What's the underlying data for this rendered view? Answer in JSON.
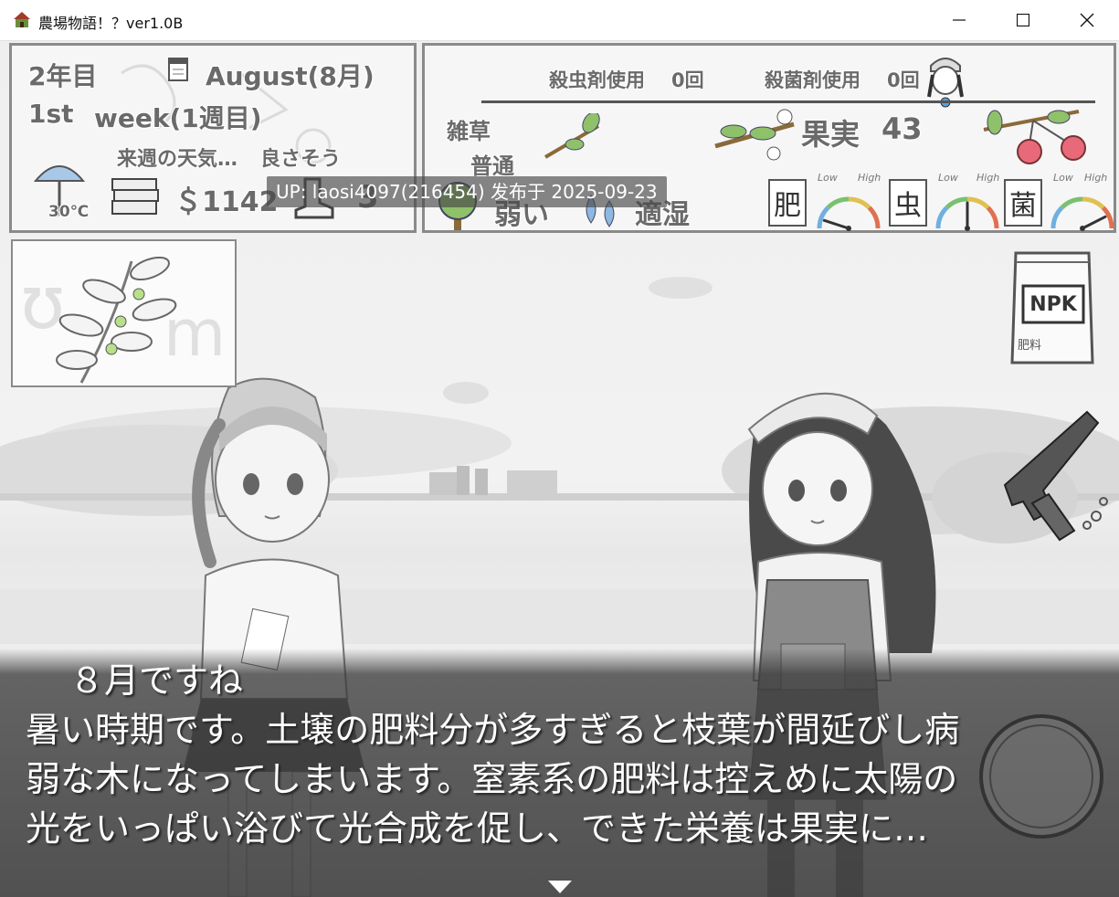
{
  "window": {
    "title": "農場物語！？ver1.0B",
    "app_icon": "farm-app-icon",
    "controls": {
      "minimize_icon": "minimize-icon",
      "maximize_icon": "maximize-icon",
      "close_icon": "close-icon"
    }
  },
  "status_left": {
    "year": "2年目",
    "month": "August(8月)",
    "week_num": "1st",
    "week": "week(1週目)",
    "forecast_label": "来週の天気…",
    "forecast_value": "良さそう",
    "temperature": "30℃",
    "money": "＄1142",
    "boot_count": "3",
    "icons": [
      "calendar-icon",
      "umbrella-icon",
      "money-stack-icon",
      "boot-icon"
    ]
  },
  "status_right": {
    "pesticide_label": "殺虫剤使用",
    "pesticide_value": "0回",
    "fungicide_label": "殺菌剤使用",
    "fungicide_value": "0回",
    "weeds_label": "雑草",
    "weeds_value": "普通",
    "fruit_label": "果実",
    "fruit_value": "43",
    "tree_status": "弱い",
    "water_status": "適湿",
    "gauges": [
      {
        "kanji": "肥",
        "low": "Low",
        "high": "High",
        "level": 0.1
      },
      {
        "kanji": "虫",
        "low": "Low",
        "high": "High",
        "level": 0.5
      },
      {
        "kanji": "菌",
        "low": "Low",
        "high": "High",
        "level": 0.85
      }
    ],
    "icons": [
      "girl-avatar-icon",
      "branch-icon",
      "flower-branch-icon",
      "cherry-icon",
      "tree-icon",
      "water-drop-icon"
    ]
  },
  "side_items": {
    "fertilizer_bag_label": "NPK",
    "fertilizer_bag_caption": "肥料",
    "icons": [
      "fertilizer-bag-icon",
      "pistol-icon",
      "plant-thumbnail"
    ]
  },
  "watermark": "UP: laosi4097(216454) 发布于 2025-09-23",
  "dialog": {
    "lines": [
      "８月ですね",
      "暑い時期です。土壌の肥料分が多すぎると枝葉が間延びし病",
      "弱な木になってしまいます。窒素系の肥料は控えめに太陽の",
      "光をいっぱい浴びて光合成を促し、できた栄養は果実に…"
    ],
    "next_icon": "advance-arrow-icon"
  }
}
